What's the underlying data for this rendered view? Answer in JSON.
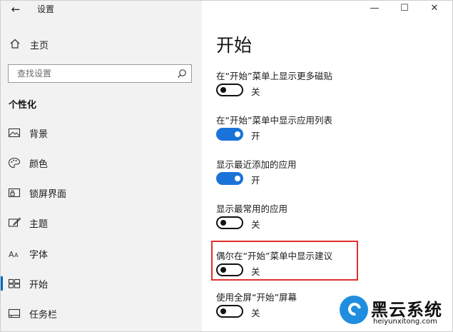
{
  "window": {
    "title": "设置",
    "back_icon": "arrow-left-icon",
    "controls": {
      "minimize": "—",
      "maximize": "☐",
      "close": "✕"
    }
  },
  "sidebar": {
    "home": {
      "label": "主页",
      "icon": "home-icon"
    },
    "search": {
      "placeholder": "查找设置",
      "icon": "search-icon"
    },
    "section_title": "个性化",
    "items": [
      {
        "label": "背景",
        "icon": "picture-icon",
        "selected": false
      },
      {
        "label": "颜色",
        "icon": "palette-icon",
        "selected": false
      },
      {
        "label": "锁屏界面",
        "icon": "lock-screen-icon",
        "selected": false
      },
      {
        "label": "主题",
        "icon": "theme-brush-icon",
        "selected": false
      },
      {
        "label": "字体",
        "icon": "font-icon",
        "selected": false
      },
      {
        "label": "开始",
        "icon": "start-menu-icon",
        "selected": true
      },
      {
        "label": "任务栏",
        "icon": "taskbar-icon",
        "selected": false
      }
    ]
  },
  "main": {
    "title": "开始",
    "settings": [
      {
        "label": "在“开始”菜单上显示更多磁贴",
        "on": false,
        "state": "关"
      },
      {
        "label": "在“开始”菜单中显示应用列表",
        "on": true,
        "state": "开"
      },
      {
        "label": "显示最近添加的应用",
        "on": true,
        "state": "开"
      },
      {
        "label": "显示最常用的应用",
        "on": false,
        "state": "关"
      },
      {
        "label": "偶尔在“开始”菜单中显示建议",
        "on": false,
        "state": "关"
      },
      {
        "label": "使用全屏“开始”屏幕",
        "on": false,
        "state": "关"
      }
    ]
  },
  "colors": {
    "accent": "#1a73d9",
    "highlight": "#e03030",
    "sidebar_bg": "#f2f2f2"
  },
  "watermark": {
    "title": "黑云系统",
    "url": "heiyunxitong.com"
  }
}
